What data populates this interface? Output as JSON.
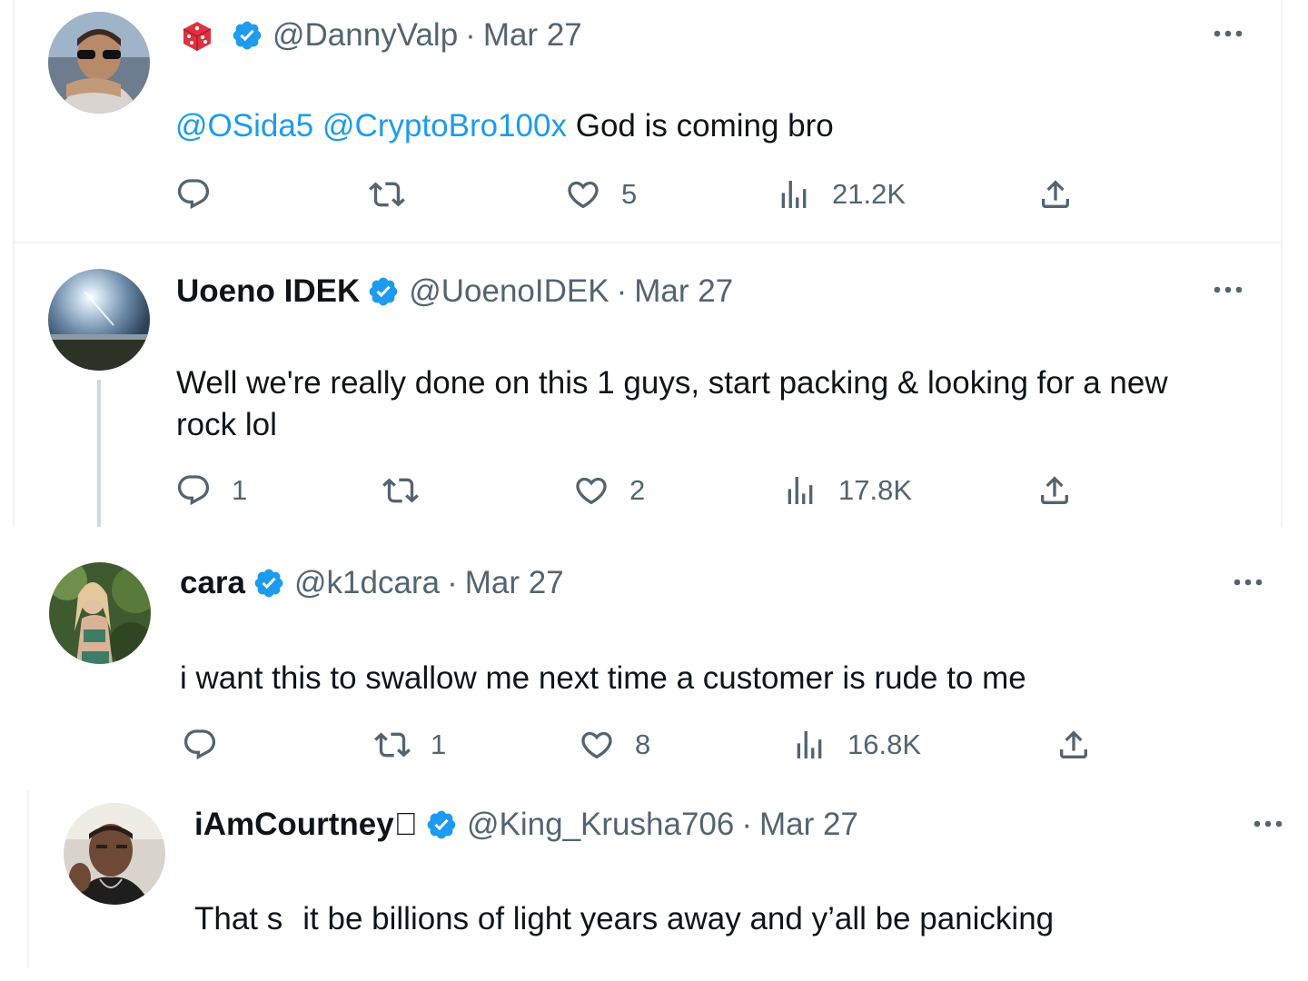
{
  "tweets": [
    {
      "display_name": "",
      "handle": "@DannyValp",
      "date": "Mar 27",
      "mentions": [
        "@OSida5",
        "@CryptoBro100x"
      ],
      "text": "God is coming bro",
      "text_lines": [],
      "replies": "",
      "retweets": "",
      "likes": "5",
      "views": "21.2K"
    },
    {
      "display_name": "Uoeno IDEK",
      "handle": "@UoenoIDEK",
      "date": "Mar 27",
      "text_lines": [
        "Well we're really done on this 1 guys, start packing & looking for a new",
        "rock lol"
      ],
      "replies": "1",
      "retweets": "",
      "likes": "2",
      "views": "17.8K"
    },
    {
      "display_name": "cara",
      "handle": "@k1dcara",
      "date": "Mar 27",
      "text_lines": [
        "i want this to swallow me next time a customer is rude to me"
      ],
      "replies": "",
      "retweets": "1",
      "likes": "8",
      "views": "16.8K"
    },
    {
      "display_name": "iAmCourtney",
      "handle": "@King_Krusha706",
      "date": "Mar 27",
      "text_lines": [
        "That s",
        "it be billions of light years away and y’all be panicking"
      ]
    }
  ],
  "separator": "·",
  "icons": {
    "reply": "reply-icon",
    "retweet": "retweet-icon",
    "like": "heart-icon",
    "views": "views-icon",
    "share": "share-icon",
    "more": "more-icon",
    "verified": "verified-badge-icon",
    "dice": "dice-icon"
  },
  "colors": {
    "accent": "#1d9bf0",
    "text": "#0f1419",
    "muted": "#536471",
    "divider": "#eff3f4"
  }
}
